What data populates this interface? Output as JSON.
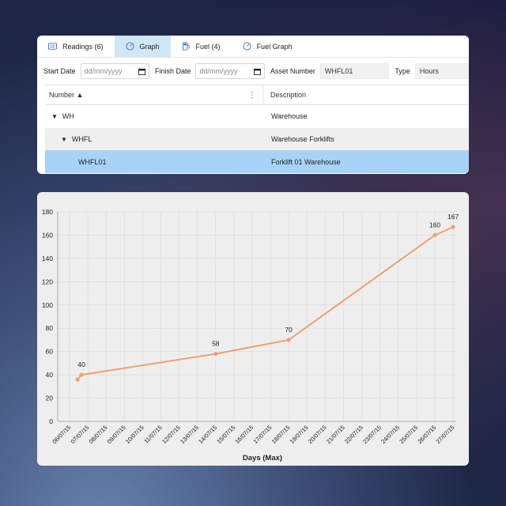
{
  "tabs": [
    {
      "label": "Readings (6)",
      "icon": "list-icon",
      "active": false
    },
    {
      "label": "Graph",
      "icon": "gauge-icon",
      "active": true
    },
    {
      "label": "Fuel (4)",
      "icon": "fuel-pump-icon",
      "active": false
    },
    {
      "label": "Fuel Graph",
      "icon": "gauge-icon",
      "active": false
    }
  ],
  "filters": {
    "start_label": "Start Date",
    "start_placeholder": "dd/mm/yyyy",
    "finish_label": "Finish Date",
    "finish_placeholder": "dd/mm/yyyy",
    "asset_label": "Asset Number",
    "asset_value": "WHFL01",
    "type_label": "Type",
    "type_value": "Hours"
  },
  "grid": {
    "col_number": "Number",
    "col_description": "Description",
    "rows": [
      {
        "number": "WH",
        "description": "Warehouse"
      },
      {
        "number": "WHFL",
        "description": "Warehouse Forklifts"
      },
      {
        "number": "WHFL01",
        "description": "Forklift 01 Warehouse"
      }
    ]
  },
  "colors": {
    "line": "#f0a070",
    "selected_row": "#a7d3f8",
    "active_tab": "#cfe7f7"
  },
  "chart_data": {
    "type": "line",
    "xlabel": "Days (Max)",
    "ylabel": "",
    "ylim": [
      0,
      180
    ],
    "yticks": [
      0,
      20,
      40,
      60,
      80,
      100,
      120,
      140,
      160,
      180
    ],
    "categories": [
      "06/07/15",
      "07/07/15",
      "08/07/15",
      "09/07/15",
      "10/07/15",
      "11/07/15",
      "12/07/15",
      "13/07/15",
      "14/07/15",
      "15/07/15",
      "16/07/15",
      "17/07/15",
      "18/07/15",
      "19/07/15",
      "20/07/15",
      "21/07/15",
      "22/07/15",
      "23/07/15",
      "24/07/15",
      "25/07/15",
      "26/07/15",
      "27/07/15"
    ],
    "grid": true,
    "points": [
      {
        "x": "06/07/15",
        "y": 36,
        "label": ""
      },
      {
        "x": "07/07/15",
        "y": 40,
        "label": "40"
      },
      {
        "x": "14/07/15",
        "y": 58,
        "label": "58"
      },
      {
        "x": "18/07/15",
        "y": 70,
        "label": "70"
      },
      {
        "x": "26/07/15",
        "y": 160,
        "label": "160"
      },
      {
        "x": "27/07/15",
        "y": 167,
        "label": "167"
      }
    ]
  }
}
